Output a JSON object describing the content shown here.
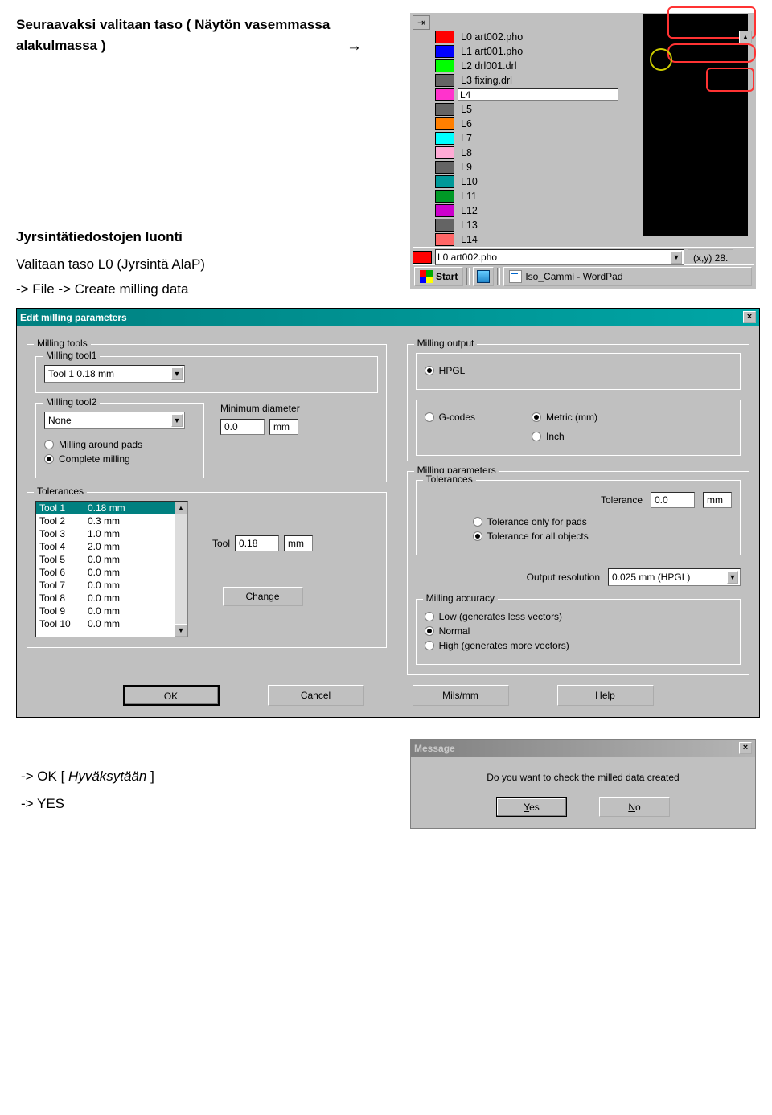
{
  "doc": {
    "line1a": "Seuraavaksi valitaan taso ( Näytön vasemmassa",
    "line1b": "alakulmassa )",
    "arrow": "→",
    "head2": "Jyrsintätiedostojen luonti",
    "line2": "Valitaan taso L0 (Jyrsintä AlaP)",
    "line3": "-> File -> Create milling data",
    "ok_line": "-> OK [ Hyväksytään ]",
    "yes_line": "-> YES"
  },
  "layers": [
    {
      "color": "#ff0000",
      "label": "L0  art002.pho"
    },
    {
      "color": "#0000ff",
      "label": "L1  art001.pho"
    },
    {
      "color": "#00ff00",
      "label": "L2  drl001.drl"
    },
    {
      "color": "#646464",
      "label": "L3  fixing.drl"
    },
    {
      "color": "#ff33cc",
      "label": "L4",
      "editable": true
    },
    {
      "color": "#646464",
      "label": "L5"
    },
    {
      "color": "#ff7f00",
      "label": "L6"
    },
    {
      "color": "#00ffff",
      "label": "L7"
    },
    {
      "color": "#ffaad5",
      "label": "L8"
    },
    {
      "color": "#646464",
      "label": "L9"
    },
    {
      "color": "#009999",
      "label": "L10"
    },
    {
      "color": "#009926",
      "label": "L11"
    },
    {
      "color": "#cc00cc",
      "label": "L12"
    },
    {
      "color": "#646464",
      "label": "L13"
    },
    {
      "color": "#ff6666",
      "label": "L14"
    }
  ],
  "layer_scroll_up": "▲",
  "status_swatch_color": "#ff0000",
  "status_combo": "L0  art002.pho",
  "status_right": "(x,y)  28.",
  "start_label": "Start",
  "taskbar_doc": "Iso_Cammi - WordPad",
  "dialog": {
    "title": "Edit milling parameters",
    "gb_tools": "Milling tools",
    "gb_tool1": "Milling tool1",
    "tool1_combo": "Tool 1   0.18 mm",
    "gb_tool2": "Milling tool2",
    "tool2_combo": "None",
    "milling_around": "Milling around pads",
    "complete_milling": "Complete milling",
    "min_diam_label": "Minimum diameter",
    "min_diam_val": "0.0",
    "unit_mm": "mm",
    "gb_tolerances": "Tolerances",
    "tool_list": [
      {
        "name": "Tool 1",
        "val": "0.18 mm",
        "sel": true
      },
      {
        "name": "Tool 2",
        "val": "0.3 mm"
      },
      {
        "name": "Tool 3",
        "val": "1.0 mm"
      },
      {
        "name": "Tool 4",
        "val": "2.0 mm"
      },
      {
        "name": "Tool 5",
        "val": "0.0 mm"
      },
      {
        "name": "Tool 6",
        "val": "0.0 mm"
      },
      {
        "name": "Tool 7",
        "val": "0.0 mm"
      },
      {
        "name": "Tool 8",
        "val": "0.0 mm"
      },
      {
        "name": "Tool 9",
        "val": "0.0 mm"
      },
      {
        "name": "Tool 10",
        "val": "0.0 mm"
      }
    ],
    "tool_label": "Tool",
    "tool_val": "0.18",
    "change_btn": "Change",
    "gb_output": "Milling output",
    "opt_hpgl": "HPGL",
    "opt_gcodes": "G-codes",
    "opt_metric": "Metric (mm)",
    "opt_inch": "Inch",
    "gb_params": "Milling parameters",
    "gb_inner_tol": "Tolerances",
    "tol_label": "Tolerance",
    "tol_val": "0.0",
    "tol_pads": "Tolerance only for pads",
    "tol_all": "Tolerance for all objects",
    "out_res_label": "Output resolution",
    "out_res_val": "0.025 mm (HPGL)",
    "gb_accuracy": "Milling accuracy",
    "acc_low": "Low (generates less vectors)",
    "acc_normal": "Normal",
    "acc_high": "High (generates more vectors)",
    "ok": "OK",
    "cancel": "Cancel",
    "mils": "Mils/mm",
    "help": "Help"
  },
  "msg": {
    "title": "Message",
    "body": "Do you want to check the milled data created",
    "yes": "Yes",
    "no": "No"
  }
}
